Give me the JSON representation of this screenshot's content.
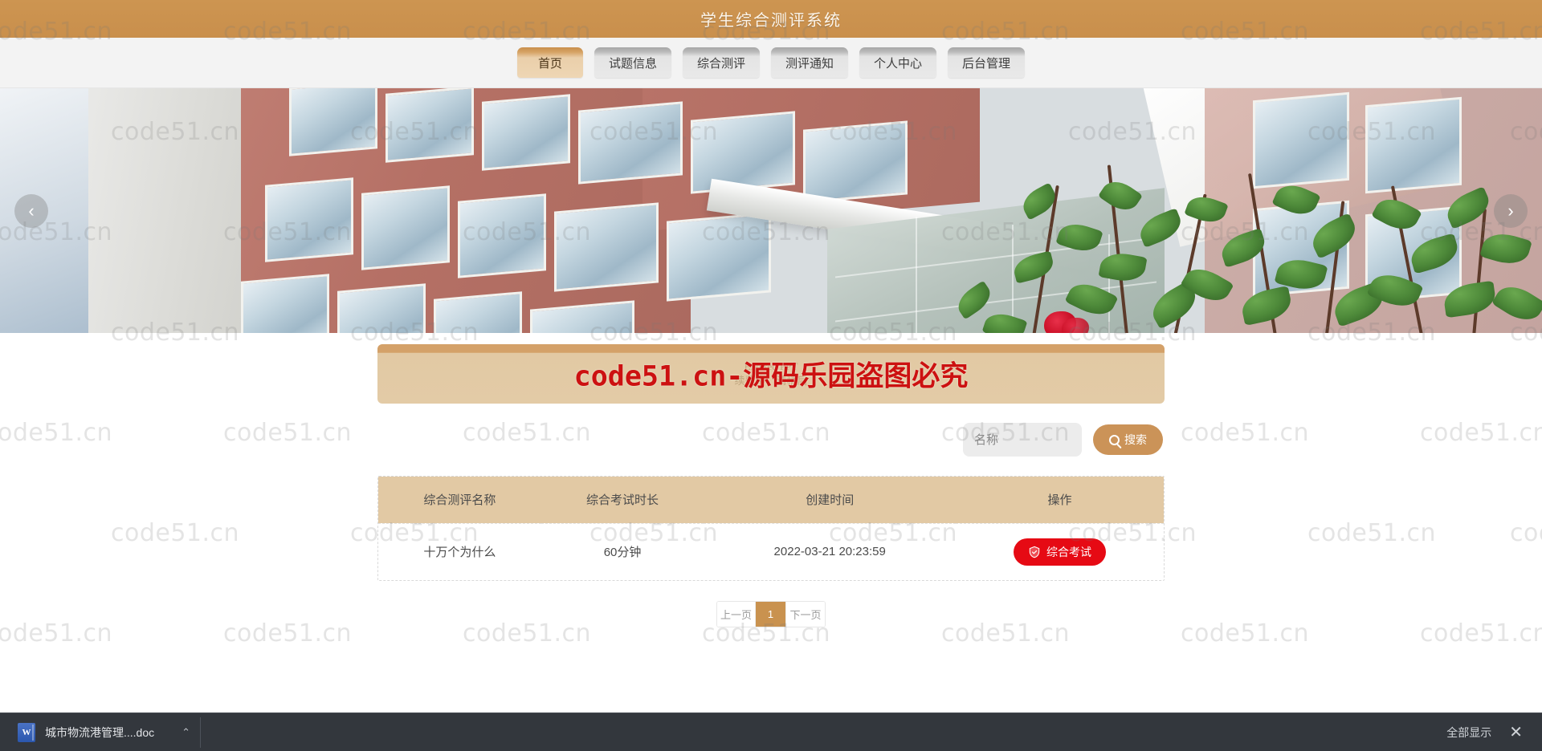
{
  "header": {
    "title": "学生综合测评系统"
  },
  "nav": {
    "items": [
      {
        "label": "首页",
        "active": true
      },
      {
        "label": "试题信息",
        "active": false
      },
      {
        "label": "综合测评",
        "active": false
      },
      {
        "label": "测评通知",
        "active": false
      },
      {
        "label": "个人中心",
        "active": false
      },
      {
        "label": "后台管理",
        "active": false
      }
    ]
  },
  "carousel": {
    "prev_icon": "chevron-left-icon",
    "next_icon": "chevron-right-icon",
    "prev_glyph": "‹",
    "next_glyph": "›"
  },
  "notice": {
    "faint_line1": "Expired PPT",
    "faint_line2": "续费中，请稍后",
    "watermark_text": "code51.cn-源码乐园盗图必究"
  },
  "search": {
    "placeholder": "名称",
    "value": "",
    "button_label": "搜索",
    "button_icon": "search-icon"
  },
  "table": {
    "columns": [
      "综合测评名称",
      "综合考试时长",
      "创建时间",
      "操作"
    ],
    "rows": [
      {
        "name": "十万个为什么",
        "duration": "60分钟",
        "created": "2022-03-21 20:23:59",
        "action_label": "综合考试",
        "action_icon": "shield-check-icon"
      }
    ]
  },
  "pagination": {
    "prev_label": "上一页",
    "next_label": "下一页",
    "pages": [
      "1"
    ],
    "current": "1"
  },
  "download_bar": {
    "file_name": "城市物流港管理....doc",
    "file_icon": "word-doc-icon",
    "caret_glyph": "⌃",
    "show_all_label": "全部显示",
    "close_glyph": "✕"
  },
  "watermark": {
    "text": "code51.cn"
  },
  "colors": {
    "brand": "#c98f4c",
    "header_bg": "#cd9551",
    "nav_bg": "#f3f3f3",
    "table_header_bg": "#e2c9a4",
    "action_red": "#e60a14",
    "pager_active": "#c9924f",
    "downloadbar_bg": "#33373d"
  }
}
